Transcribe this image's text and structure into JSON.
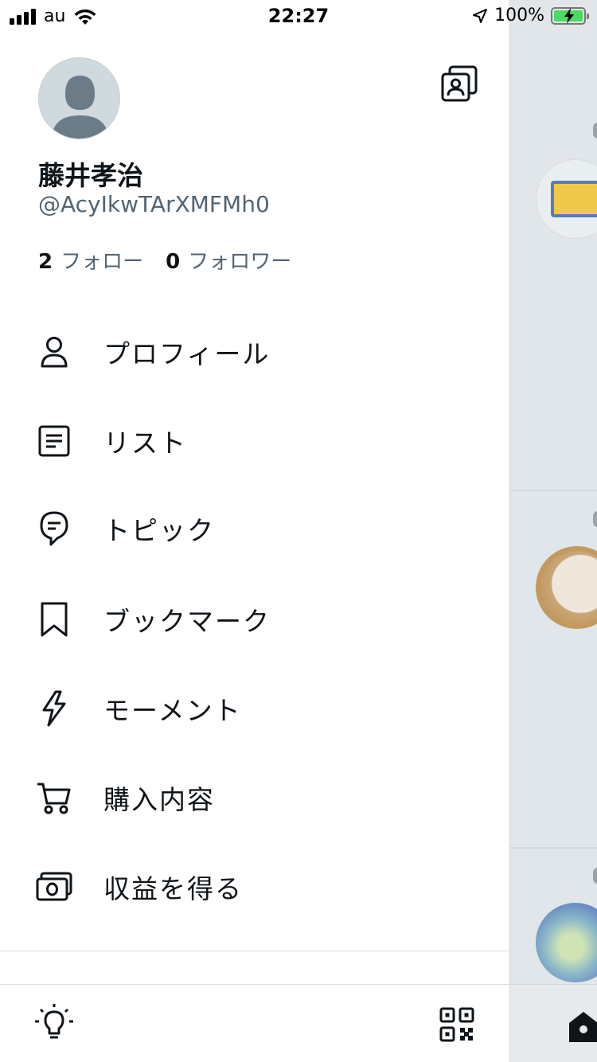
{
  "status_bar": {
    "carrier": "au",
    "time": "22:27",
    "battery_percent": "100%"
  },
  "profile": {
    "display_name": "藤井孝治",
    "handle": "@AcyIkwTArXMFMh0",
    "following_count": "2",
    "following_label": "フォロー",
    "followers_count": "0",
    "followers_label": "フォロワー"
  },
  "menu": {
    "items": [
      {
        "label": "プロフィール",
        "icon": "person-icon"
      },
      {
        "label": "リスト",
        "icon": "list-icon"
      },
      {
        "label": "トピック",
        "icon": "topic-icon"
      },
      {
        "label": "ブックマーク",
        "icon": "bookmark-icon"
      },
      {
        "label": "モーメント",
        "icon": "lightning-icon"
      },
      {
        "label": "購入内容",
        "icon": "cart-icon"
      },
      {
        "label": "収益を得る",
        "icon": "money-icon"
      }
    ]
  },
  "bottom_bar": {
    "left_icon": "lightbulb-icon",
    "right_icon": "qr-code-icon"
  },
  "colors": {
    "text_primary": "#0f1419",
    "text_secondary": "#536471",
    "divider": "#d8dde1",
    "backdrop": "#e1e6ea"
  }
}
